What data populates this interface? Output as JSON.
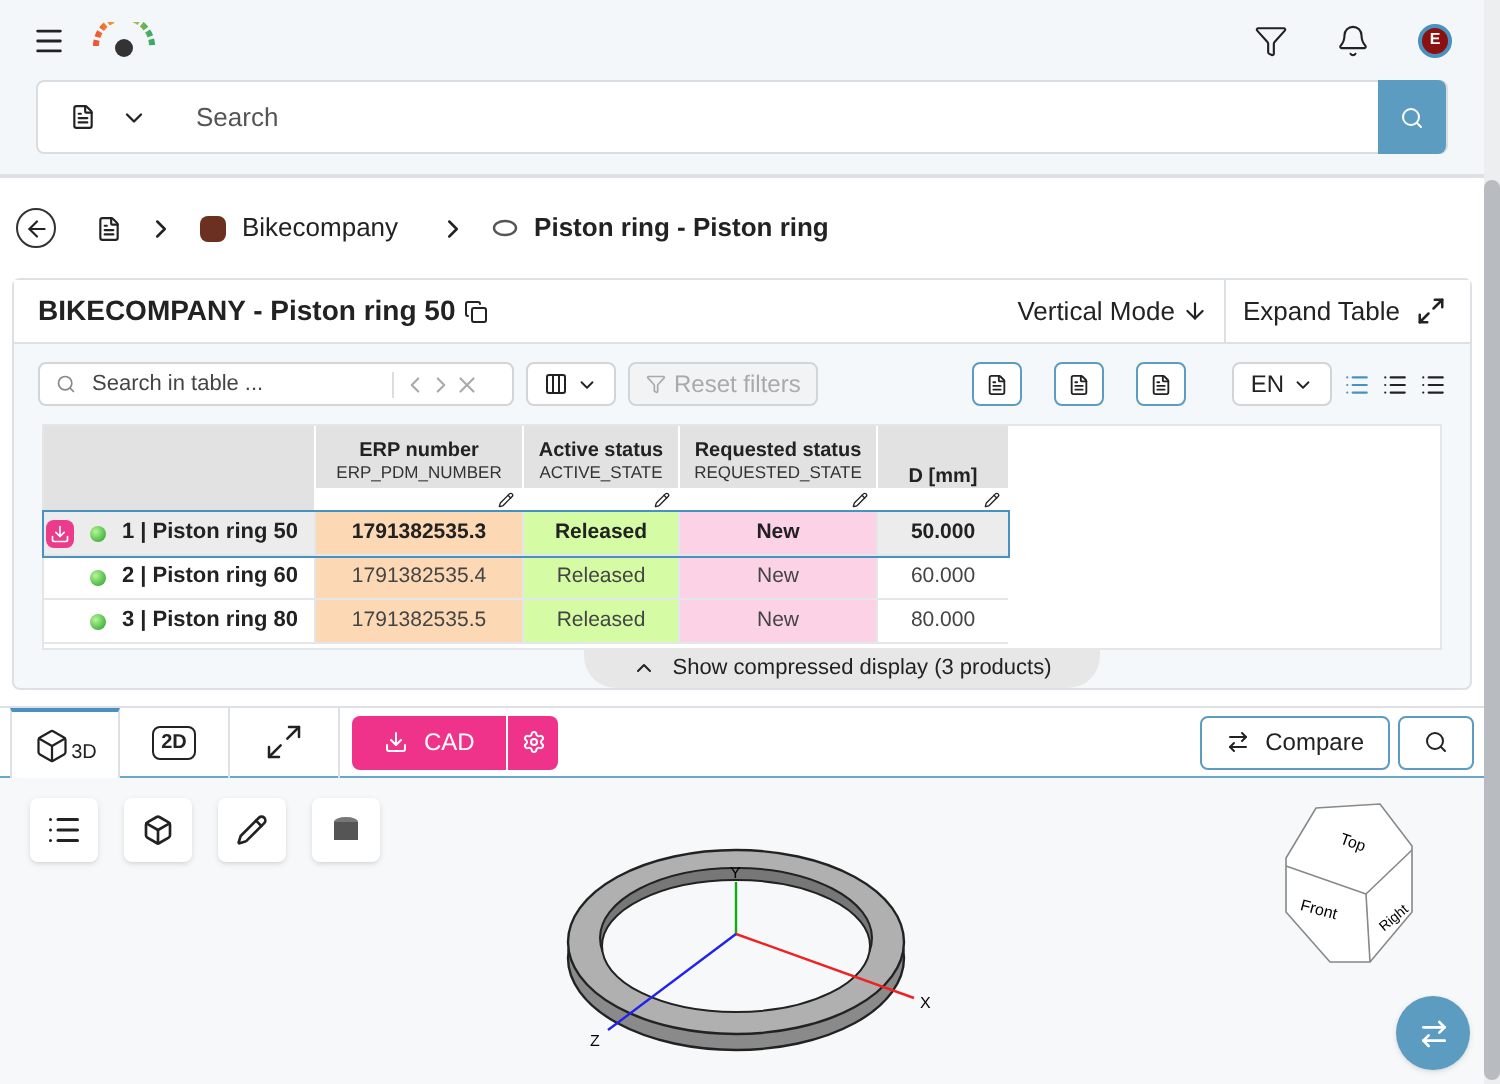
{
  "header": {
    "avatar_initial": "E"
  },
  "search": {
    "placeholder": "Search"
  },
  "breadcrumb": [
    {
      "label": "Bikecompany"
    },
    {
      "label": "Piston ring - Piston ring"
    }
  ],
  "card": {
    "title": "BIKECOMPANY - Piston ring 50",
    "actions": [
      "Vertical Mode",
      "Expand Table"
    ],
    "table_search": {
      "placeholder": "Search in table ..."
    },
    "reset_filters": {
      "label": "Reset filters",
      "disabled": true
    },
    "language": "EN",
    "view_modes": [
      {
        "selected": true
      },
      {
        "selected": false
      },
      {
        "selected": false
      }
    ]
  },
  "table": {
    "columns": [
      {
        "title": "ERP number",
        "field": "ERP_PDM_NUMBER",
        "color": "#fcd9b4"
      },
      {
        "title": "Active status",
        "field": "ACTIVE_STATE",
        "color": "#d5fca4"
      },
      {
        "title": "Requested status",
        "field": "REQUESTED_STATE",
        "color": "#fcd3e6"
      },
      {
        "title": "D [mm]"
      }
    ],
    "rows": [
      {
        "name": "1 | Piston ring 50",
        "selected": true,
        "cells": [
          "1791382535.3",
          "Released",
          "New",
          "50.000"
        ]
      },
      {
        "name": "2 | Piston ring 60",
        "selected": false,
        "cells": [
          "1791382535.4",
          "Released",
          "New",
          "60.000"
        ]
      },
      {
        "name": "3 | Piston ring 80",
        "selected": false,
        "cells": [
          "1791382535.5",
          "Released",
          "New",
          "80.000"
        ]
      }
    ],
    "compressed_toggle": "Show compressed display (3 products)"
  },
  "viewer": {
    "tabs": [
      {
        "kind": "solid",
        "label": "3D",
        "selected": true
      },
      {
        "kind": "flat",
        "label": "2D",
        "selected": false
      },
      {
        "kind": "measure",
        "selected": false
      }
    ],
    "cad_button": "CAD",
    "compare_button": "Compare",
    "axes": [
      "X",
      "Y",
      "Z"
    ],
    "view_cube": [
      "Top",
      "Front",
      "Right"
    ]
  }
}
